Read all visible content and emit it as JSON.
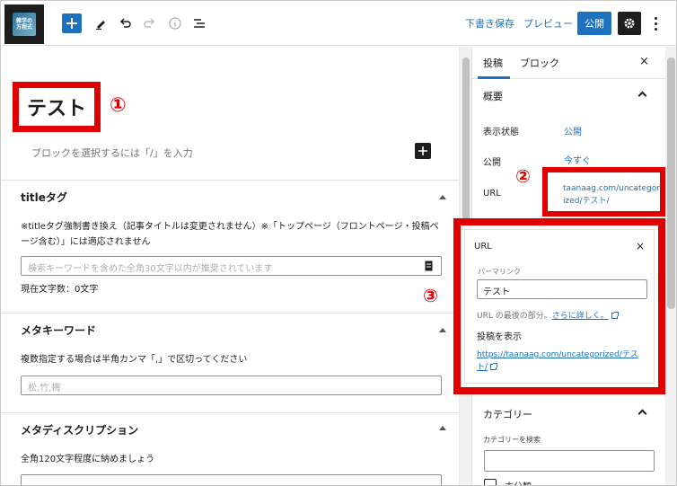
{
  "toolbar": {
    "logo_line1": "雑学の",
    "logo_line2": "方程式",
    "save_draft": "下書き保存",
    "preview": "プレビュー",
    "publish": "公開"
  },
  "editor": {
    "title": "テスト",
    "badge_1": "①",
    "placeholder": "ブロックを選択するには「/」を入力",
    "title_tag": {
      "heading": "titleタグ",
      "desc": "※titleタグ強制書き換え（記事タイトルは変更されません）※「トップページ（フロントページ・投稿ページ含む）」には適応されません",
      "input_placeholder": "検索キーワードを含めた全角30文字以内が推奨されています",
      "counter": "現在文字数：0文字"
    },
    "meta_keywords": {
      "heading": "メタキーワード",
      "desc": "複数指定する場合は半角カンマ「,」で区切ってください",
      "input_placeholder": "松,竹,梅"
    },
    "meta_description": {
      "heading": "メタディスクリプション",
      "desc": "全角120文字程度に納めましょう"
    }
  },
  "sidebar": {
    "tab_post": "投稿",
    "tab_block": "ブロック",
    "close": "×",
    "summary_heading": "概要",
    "visibility_label": "表示状態",
    "visibility_value": "公開",
    "publish_label": "公開",
    "publish_value": "今すぐ",
    "url_label": "URL",
    "url_value": "taanaag.com/uncategorized/テスト/",
    "badge_2": "②",
    "badge_3": "③",
    "category_heading": "カテゴリー",
    "category_search_label": "カテゴリーを検索",
    "category_first": "未分類"
  },
  "url_popover": {
    "title": "URL",
    "close": "×",
    "permalink_label": "パーマリンク",
    "permalink_value": "テスト",
    "help_prefix": "URL の最後の部分。",
    "help_link": "さらに詳しく。",
    "view_post_label": "投稿を表示",
    "view_post_link": "https://taanaag.com/uncategorized/テスト/"
  }
}
